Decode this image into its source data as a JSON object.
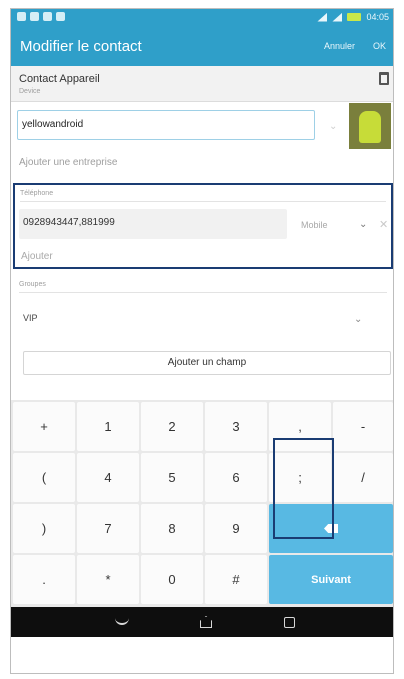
{
  "app_bar": {
    "title": "Modifier le contact",
    "cancel_label": "Annuler",
    "ok_label": "OK"
  },
  "status_bar": {
    "time": "04:05"
  },
  "account": {
    "name": "Contact Appareil",
    "type": "Device"
  },
  "name_field": {
    "value": "yellowandroid"
  },
  "company": {
    "placeholder": "Ajouter une entreprise"
  },
  "phone": {
    "header": "Téléphone",
    "value": "0928943447,881999",
    "type": "Mobile",
    "add_label": "Ajouter"
  },
  "groups": {
    "header": "Groupes",
    "value": "VIP"
  },
  "add_field_label": "Ajouter un champ",
  "keyboard": {
    "rows": [
      [
        "+",
        "1",
        "2",
        "3",
        ",",
        "-"
      ],
      [
        "(",
        "4",
        "5",
        "6",
        ";",
        "/"
      ],
      [
        ")",
        "7",
        "8",
        "9"
      ],
      [
        ".",
        "*",
        "0",
        "#"
      ]
    ],
    "next_label": "Suivant"
  },
  "icons": {
    "account": "device-icon",
    "delete": "close-icon",
    "chevron": "chevron-down-icon",
    "backspace": "backspace-icon"
  },
  "colors": {
    "accent": "#2f9fc9",
    "action_key": "#58b9e3",
    "highlight": "#1a3c73"
  }
}
